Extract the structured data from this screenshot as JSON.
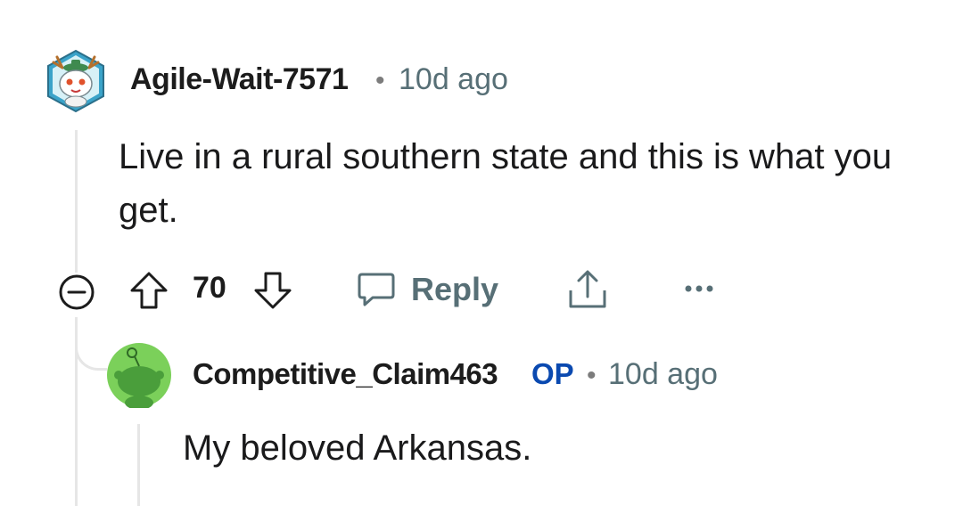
{
  "comments": [
    {
      "author": "Agile-Wait-7571",
      "separator": "•",
      "age": "10d ago",
      "body": "Live in a rural southern state and this is what you get.",
      "score": "70",
      "reply_label": "Reply"
    },
    {
      "author": "Competitive_Claim463",
      "op_badge": "OP",
      "separator": "•",
      "age": "10d ago",
      "body": "My beloved Arkansas."
    }
  ],
  "icons": {
    "collapse": "minus-circle-icon",
    "upvote": "arrow-up-outline-icon",
    "downvote": "arrow-down-outline-icon",
    "reply": "speech-bubble-icon",
    "share": "share-upload-icon",
    "more": "ellipsis-icon"
  },
  "colors": {
    "meta_text": "#576f76",
    "op_badge": "#0a49b0",
    "avatar2_bg": "#7bd05a",
    "thread_line": "#e6e6e6"
  }
}
